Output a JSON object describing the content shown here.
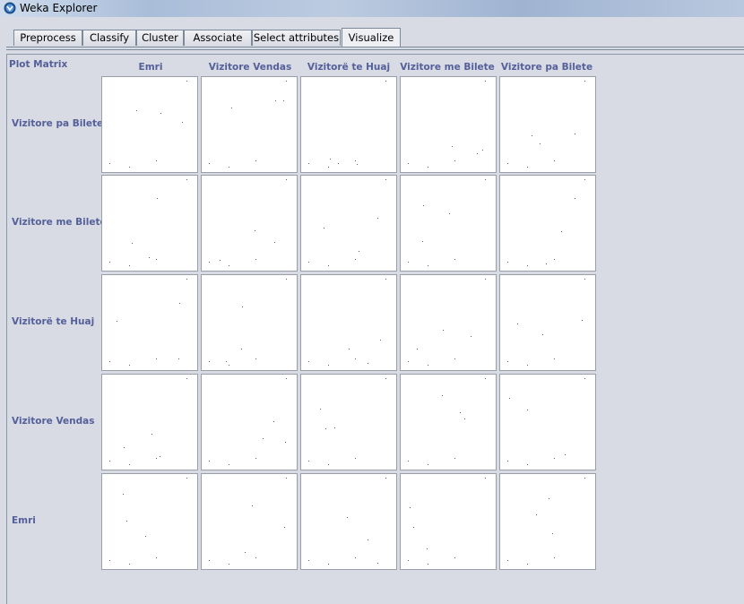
{
  "window": {
    "title": "Weka Explorer"
  },
  "tabs": [
    {
      "label": "Preprocess",
      "active": false
    },
    {
      "label": "Classify",
      "active": false
    },
    {
      "label": "Cluster",
      "active": false
    },
    {
      "label": "Associate",
      "active": false
    },
    {
      "label": "Select attributes",
      "active": false
    },
    {
      "label": "Visualize",
      "active": true
    }
  ],
  "plot_matrix": {
    "title": "Plot Matrix",
    "column_attributes": [
      "Emri",
      "Vizitore Vendas",
      "Vizitorë te Huaj",
      "Vizitore me Bilete",
      "Vizitore pa Bilete"
    ],
    "row_attributes": [
      "Vizitore pa Bilete",
      "Vizitore me Bilete",
      "Vizitorë te Huaj",
      "Vizitore Vendas",
      "Emri"
    ],
    "point_color": "#5a6270",
    "label_color": "#55609a"
  }
}
